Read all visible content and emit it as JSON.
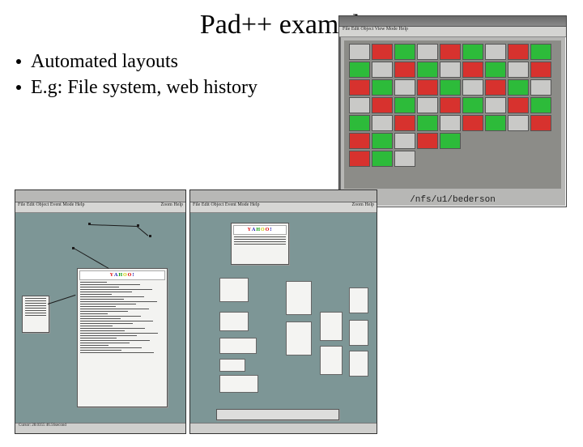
{
  "title": "Pad++ examples",
  "bullets": [
    "Automated layouts",
    "E.g:  File system, web history"
  ],
  "filesystem": {
    "menu": "File Edit Object View Mode Help",
    "path_caption": "/nfs/u1/bederson"
  },
  "webhistory": {
    "menu_left": "File Edit Object Event Mode Help",
    "menu_right": "Zoom Help",
    "status_left": "Cursor: 28.0355 46.56second",
    "status_right": "",
    "yahoo_label": "YAHOO!"
  }
}
